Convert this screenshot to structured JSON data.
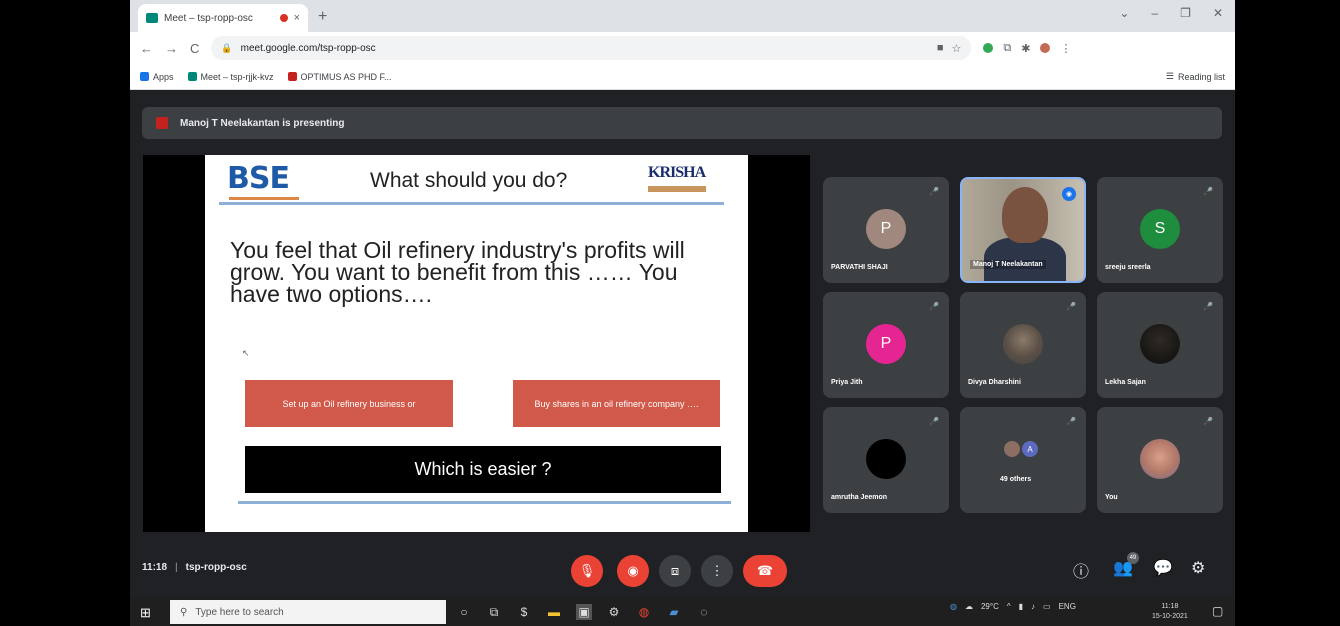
{
  "browser": {
    "tab_title": "Meet – tsp-ropp-osc",
    "tab_close": "×",
    "new_tab": "+",
    "window_controls": [
      "⌄",
      "–",
      "❐",
      "✕"
    ],
    "url": "meet.google.com/tsp-ropp-osc",
    "nav": [
      "←",
      "→",
      "C"
    ],
    "bookmarks": [
      {
        "label": "Apps",
        "icon": "apps-grid-icon"
      },
      {
        "label": "Meet – tsp-rjjk-kvz",
        "icon": "meet-icon"
      },
      {
        "label": "OPTIMUS AS PHD F...",
        "icon": "bookmark-icon"
      }
    ],
    "reading_list": "Reading list"
  },
  "meet": {
    "presenter_banner": "Manoj T Neelakantan is presenting",
    "slide": {
      "logo_left": "BSE",
      "title": "What should you do?",
      "logo_right": "KRISHA",
      "body": "You feel that Oil refinery industry's profits will grow. You want to benefit from this …… You have two options….",
      "option_1": "Set up an Oil refinery business or",
      "option_2": "Buy shares in an oil refinery company ….",
      "question": "Which is easier ?"
    },
    "participants": [
      {
        "name": "PARVATHI SHAJI",
        "initial": "P",
        "color": "#a1887f"
      },
      {
        "name": "Manoj T Neelakantan",
        "initial": "",
        "color": ""
      },
      {
        "name": "sreeju sreerla",
        "initial": "S",
        "color": "#1e8e3e"
      },
      {
        "name": "Priya Jith",
        "initial": "P",
        "color": "#e52592"
      },
      {
        "name": "Divya Dharshini",
        "initial": "",
        "color": ""
      },
      {
        "name": "Lekha Sajan",
        "initial": "",
        "color": ""
      },
      {
        "name": "amrutha Jeemon",
        "initial": "",
        "color": ""
      },
      {
        "name": "49 others",
        "initial": "A",
        "color": "#5c6bc0"
      },
      {
        "name": "You",
        "initial": "",
        "color": ""
      }
    ],
    "time": "11:18",
    "separator": "|",
    "meeting_code": "tsp-ropp-osc",
    "participant_count": "49"
  },
  "taskbar": {
    "search_placeholder": "Type here to search",
    "weather": "29°C",
    "language": "ENG",
    "time": "11:18",
    "date": "15-10-2021"
  }
}
